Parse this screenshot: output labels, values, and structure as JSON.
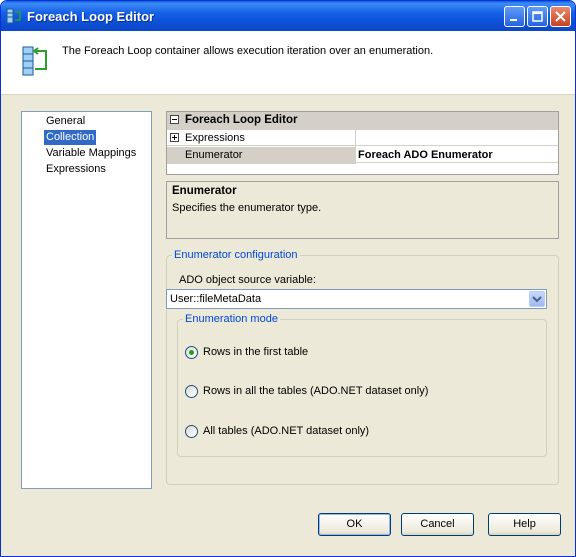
{
  "window": {
    "title": "Foreach Loop Editor"
  },
  "header": {
    "description": "The Foreach Loop container allows execution iteration over an enumeration."
  },
  "nav": {
    "items": [
      {
        "label": "General",
        "selected": false
      },
      {
        "label": "Collection",
        "selected": true
      },
      {
        "label": "Variable Mappings",
        "selected": false
      },
      {
        "label": "Expressions",
        "selected": false
      }
    ]
  },
  "grid": {
    "header": "Foreach Loop Editor",
    "expressions_label": "Expressions",
    "enumerator_label": "Enumerator",
    "enumerator_value": "Foreach ADO Enumerator"
  },
  "description": {
    "title": "Enumerator",
    "text": "Specifies the enumerator type."
  },
  "config": {
    "legend": "Enumerator configuration",
    "ado_label": "ADO object source variable:",
    "ado_value": "User::fileMetaData",
    "mode_legend": "Enumeration mode",
    "options": [
      {
        "label": "Rows in the first table",
        "checked": true
      },
      {
        "label": "Rows in all the tables (ADO.NET dataset only)",
        "checked": false
      },
      {
        "label": "All tables (ADO.NET dataset only)",
        "checked": false
      }
    ]
  },
  "buttons": {
    "ok": "OK",
    "cancel": "Cancel",
    "help": "Help"
  }
}
